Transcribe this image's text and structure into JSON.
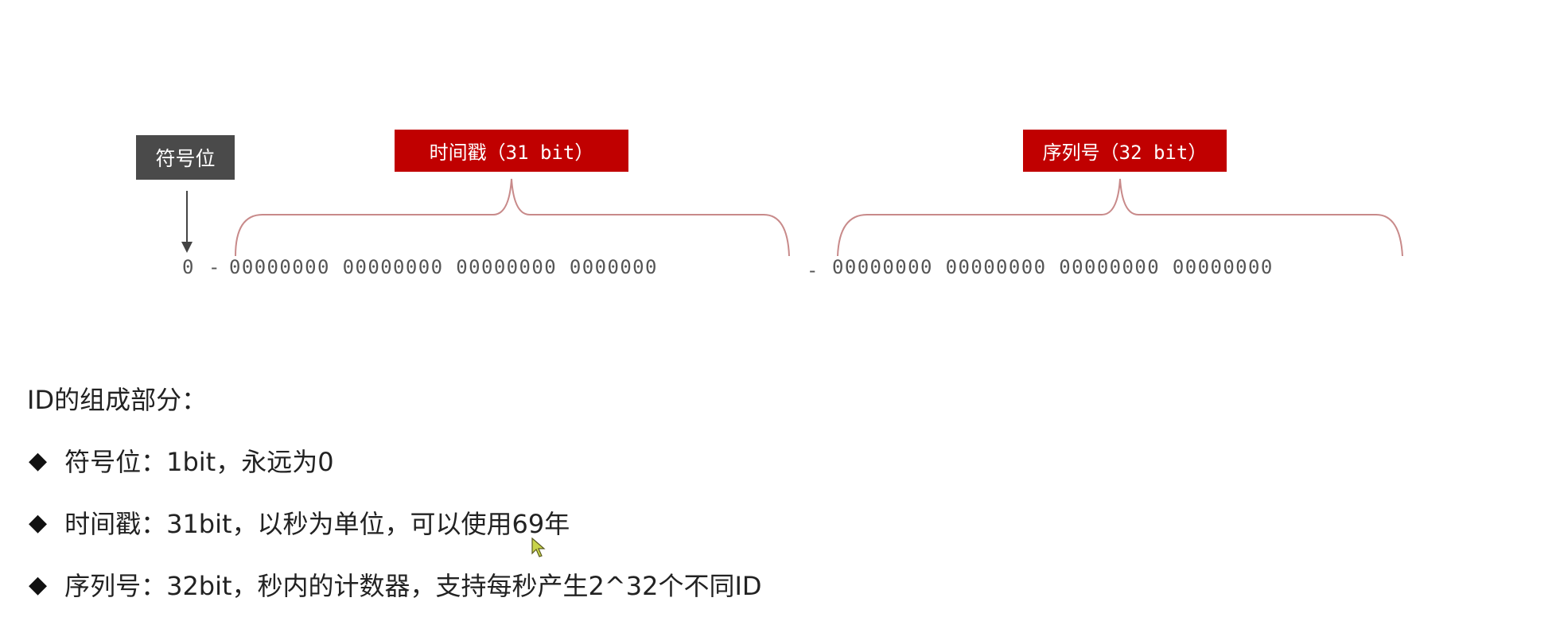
{
  "labels": {
    "sign": "符号位",
    "timestamp": "时间戳（31 bit）",
    "sequence": "序列号（32 bit）"
  },
  "bits": {
    "sign": "0",
    "separator": "-",
    "timestamp": "00000000 00000000 00000000 0000000",
    "sequence": "00000000 00000000 00000000 00000000"
  },
  "composition": {
    "title": "ID的组成部分：",
    "items": [
      {
        "marker": "◆",
        "text": "符号位：1bit，永远为0"
      },
      {
        "marker": "◆",
        "text": "时间戳：31bit，以秒为单位，可以使用69年"
      },
      {
        "marker": "◆",
        "text": "序列号：32bit，秒内的计数器，支持每秒产生2^32个不同ID"
      }
    ]
  },
  "colors": {
    "accent_red": "#c00000",
    "sign_gray": "#4a4a4a",
    "brace": "#c88a8a"
  }
}
